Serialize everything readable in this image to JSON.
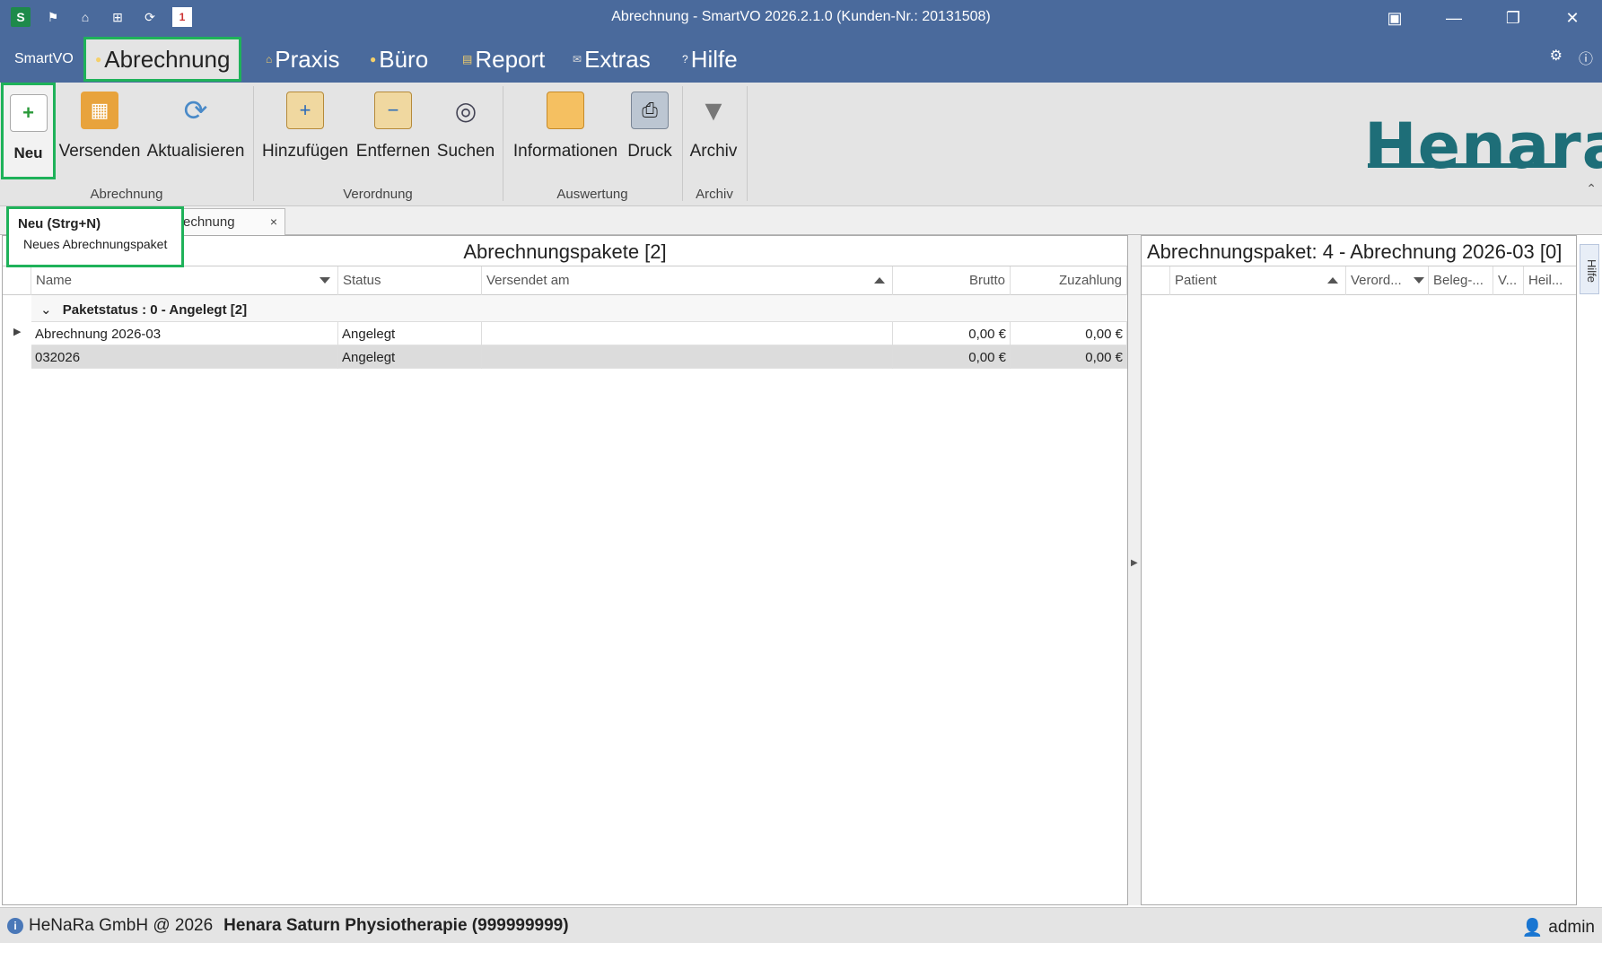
{
  "window": {
    "title": "Abrechnung - SmartVO 2026.2.1.0 (Kunden-Nr.: 20131508)",
    "app_logo": "S",
    "quick_access_icons": [
      "flag-icon",
      "home-icon",
      "network-icon",
      "refresh-icon",
      "calendar-icon"
    ],
    "calendar_day": "1"
  },
  "menu": {
    "smartvo_label": "SmartVO",
    "items": [
      {
        "label": "Abrechnung",
        "active": true
      },
      {
        "label": "Praxis"
      },
      {
        "label": "Büro"
      },
      {
        "label": "Report"
      },
      {
        "label": "Extras"
      },
      {
        "label": "Hilfe"
      }
    ]
  },
  "ribbon": {
    "buttons": {
      "neu": "Neu",
      "versenden": "Versenden",
      "aktualisieren": "Aktualisieren",
      "hinzufuegen": "Hinzufügen",
      "entfernen": "Entfernen",
      "suchen": "Suchen",
      "informationen": "Informationen",
      "druck": "Druck",
      "archiv": "Archiv"
    },
    "groups": {
      "abrechnung": "Abrechnung",
      "verordnung": "Verordnung",
      "auswertung": "Auswertung",
      "archiv": "Archiv"
    },
    "brand_logo": "Henara"
  },
  "tooltip": {
    "title": "Neu (Strg+N)",
    "description": "Neues Abrechnungspaket"
  },
  "doc_tab": {
    "label": "rechnung",
    "close": "×"
  },
  "left_pane": {
    "title": "Abrechnungspakete [2]",
    "columns": [
      "Name",
      "Status",
      "Versendet am",
      "Brutto",
      "Zuzahlung"
    ],
    "group_label": "Paketstatus : 0 - Angelegt [2]",
    "rows": [
      {
        "name": "Abrechnung 2026-03",
        "status": "Angelegt",
        "versendet": "",
        "brutto": "0,00 €",
        "zuzahlung": "0,00 €"
      },
      {
        "name": "032026",
        "status": "Angelegt",
        "versendet": "",
        "brutto": "0,00 €",
        "zuzahlung": "0,00 €"
      }
    ]
  },
  "right_pane": {
    "title": "Abrechnungspaket: 4 - Abrechnung 2026-03 [0]",
    "columns": [
      "Patient",
      "Verord...",
      "Beleg-...",
      "V...",
      "Heil..."
    ]
  },
  "side_tab": {
    "label": "Hilfe"
  },
  "status": {
    "company": "HeNaRa GmbH @ 2026",
    "practice": "Henara Saturn Physiotherapie (999999999)",
    "user": "admin"
  },
  "colors": {
    "title_bar": "#4a6a9c",
    "highlight": "#1fb25a",
    "ribbon": "#e4e4e4",
    "brand": "#1e6e78"
  }
}
